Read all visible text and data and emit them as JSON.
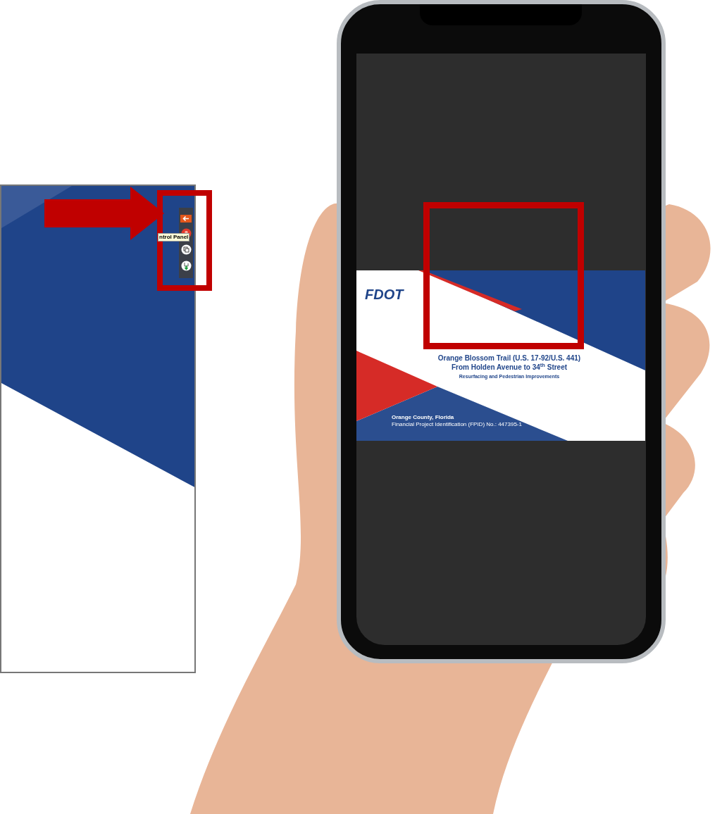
{
  "side_panel": {
    "toolbar": [
      {
        "kind": "back"
      },
      {
        "kind": "alert"
      },
      {
        "kind": "copy"
      },
      {
        "kind": "download"
      }
    ],
    "tooltip": "ntrol Panel"
  },
  "phone": {
    "slide": {
      "logo": "FDOT",
      "title": "Orange Blossom Trail (U.S. 17-92/U.S. 441)",
      "subtitle": "From Holden Avenue to 34$^{th}$ Street",
      "project": "Resurfacing and Pedestrian Improvements",
      "county": "Orange County, Florida",
      "fpid": "Financial Project Identification (FPID) No.: 447395-1"
    }
  }
}
